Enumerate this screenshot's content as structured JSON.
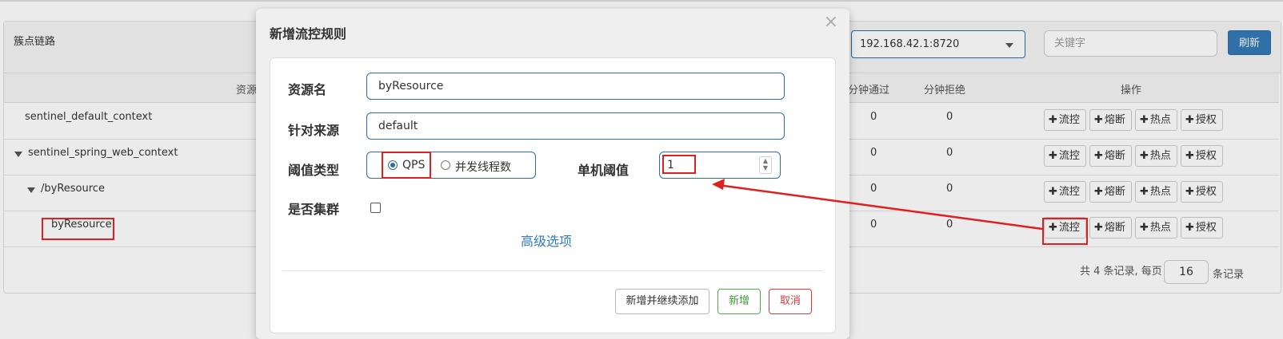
{
  "panel": {
    "title": "簇点链路"
  },
  "toolbar": {
    "machine": "192.168.42.1:8720",
    "keyword_placeholder": "关键字",
    "refresh": "刷新"
  },
  "table": {
    "headers": {
      "resource": "资源",
      "pass_qps": "分钟通过",
      "block_qps": "分钟拒绝",
      "ops": "操作"
    },
    "rows": [
      {
        "name": "sentinel_default_context",
        "pass": "0",
        "block": "0"
      },
      {
        "name": "sentinel_spring_web_context",
        "pass": "0",
        "block": "0"
      },
      {
        "name": "/byResource",
        "pass": "0",
        "block": "0"
      },
      {
        "name": "byResource",
        "pass": "0",
        "block": "0"
      }
    ],
    "op_labels": {
      "flow": "流控",
      "degrade": "熔断",
      "hot": "热点",
      "auth": "授权"
    },
    "op_plus": "✚"
  },
  "pager": {
    "prefix": "共 4 条记录, 每页",
    "page_size": "16",
    "suffix": "条记录"
  },
  "modal": {
    "title": "新增流控规则",
    "close": "×",
    "resource_label": "资源名",
    "resource_value": "byResource",
    "origin_label": "针对来源",
    "origin_value": "default",
    "grade_label": "阈值类型",
    "grade_qps": "QPS",
    "grade_thread": "并发线程数",
    "count_label": "单机阈值",
    "count_value": "1",
    "cluster_label": "是否集群",
    "advanced": "高级选项",
    "btn_continue": "新增并继续添加",
    "btn_add": "新增",
    "btn_cancel": "取消"
  },
  "colors": {
    "primary": "#337ab7",
    "success": "#4cae4c",
    "danger": "#d43f3a",
    "annotation": "#e02020"
  }
}
